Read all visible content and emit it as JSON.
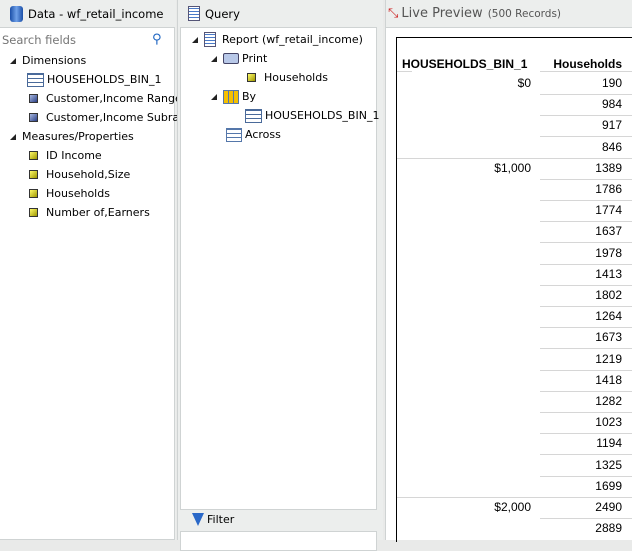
{
  "data_panel": {
    "title": "Data - wf_retail_income",
    "search_placeholder": "Search fields",
    "dimensions_label": "Dimensions",
    "dimensions": [
      "HOUSEHOLDS_BIN_1",
      "Customer,Income Range",
      "Customer,Income Subrange"
    ],
    "measures_label": "Measures/Properties",
    "measures": [
      "ID Income",
      "Household,Size",
      "Households",
      "Number of,Earners"
    ]
  },
  "query_panel": {
    "title": "Query",
    "report": "Report (wf_retail_income)",
    "print": "Print",
    "print_field": "Households",
    "by": "By",
    "by_field": "HOUSEHOLDS_BIN_1",
    "across": "Across",
    "filter": "Filter"
  },
  "preview": {
    "title": "Live Preview",
    "records": "(500 Records)",
    "columns": [
      "HOUSEHOLDS_BIN_1",
      "Households"
    ],
    "groups": [
      {
        "bin": "$0",
        "values": [
          "190",
          "984",
          "917",
          "846"
        ]
      },
      {
        "bin": "$1,000",
        "values": [
          "1389",
          "1786",
          "1774",
          "1637",
          "1978",
          "1413",
          "1802",
          "1264",
          "1673",
          "1219",
          "1418",
          "1282",
          "1023",
          "1194",
          "1325",
          "1699"
        ]
      },
      {
        "bin": "$2,000",
        "values": [
          "2490",
          "2889"
        ]
      }
    ]
  }
}
